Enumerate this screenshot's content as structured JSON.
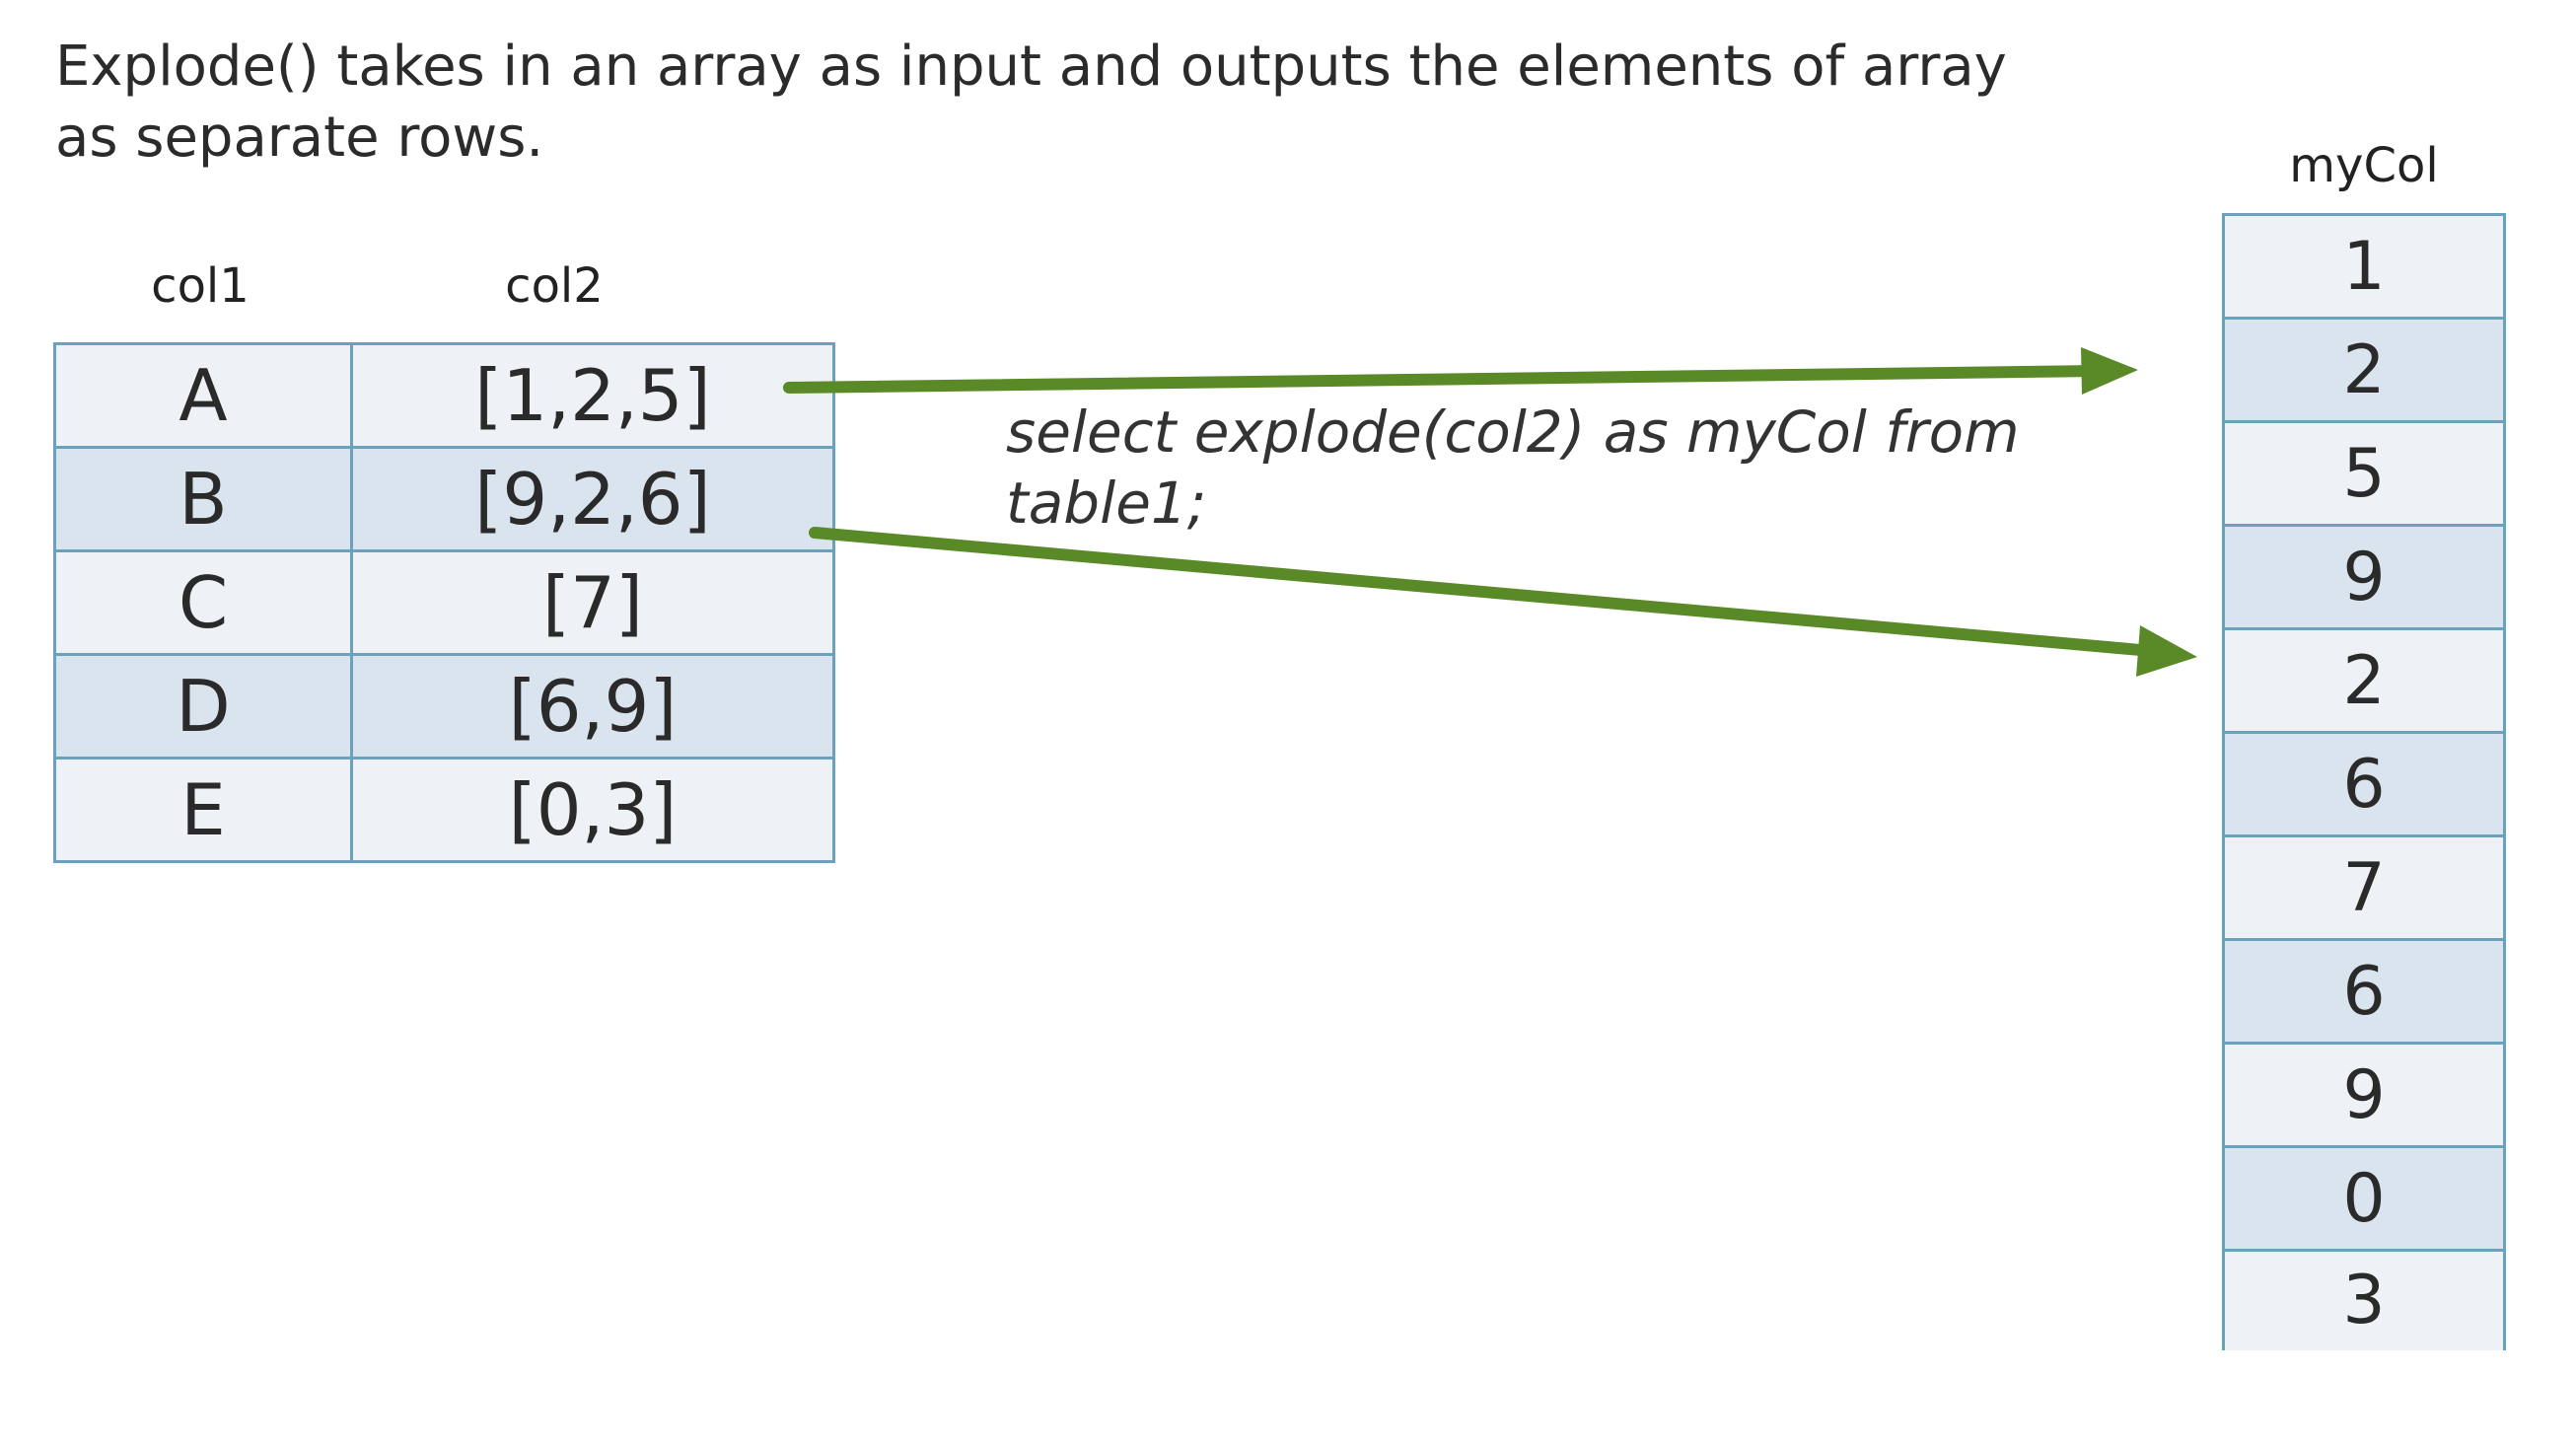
{
  "intro_text": "Explode() takes in an array as input and outputs the elements of array as separate rows.",
  "source_table": {
    "headers": [
      "col1",
      "col2"
    ],
    "rows": [
      {
        "col1": "A",
        "col2": "[1,2,5]"
      },
      {
        "col1": "B",
        "col2": "[9,2,6]"
      },
      {
        "col1": "C",
        "col2": "[7]"
      },
      {
        "col1": "D",
        "col2": "[6,9]"
      },
      {
        "col1": "E",
        "col2": "[0,3]"
      }
    ]
  },
  "query_text": "select  explode(col2) as myCol from table1;",
  "output_table": {
    "header": "myCol",
    "values": [
      "1",
      "2",
      "5",
      "9",
      "2",
      "6",
      "7",
      "6",
      "9",
      "0",
      "3"
    ]
  },
  "colors": {
    "arrow": "#5a8a28",
    "highlight_row_a": "#e9ee2e",
    "highlight_row_b": "#e09a52",
    "cell_border": "#6aa2bd",
    "row_light": "#eef2f7",
    "row_dark": "#d9e4ee"
  }
}
